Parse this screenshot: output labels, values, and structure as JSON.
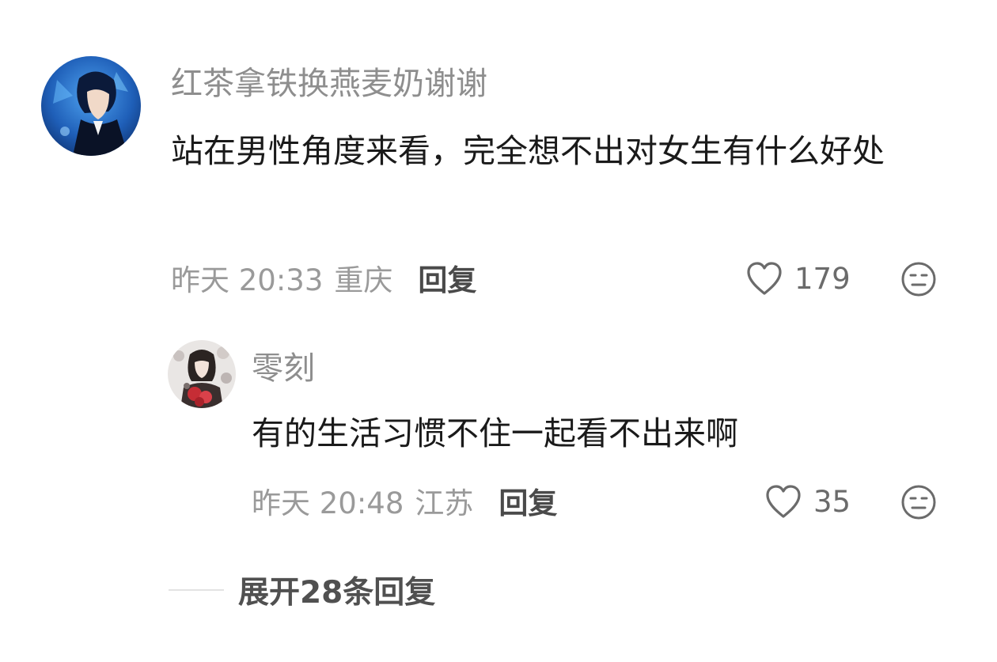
{
  "comments": [
    {
      "username": "红茶拿铁换燕麦奶谢谢",
      "text": "站在男性角度来看，完全想不出对女生有什么好处",
      "time": "昨天 20:33",
      "location": "重庆",
      "reply_label": "回复",
      "likes": "179",
      "avatar_icon": "anime-boy-blue-avatar"
    },
    {
      "username": "零刻",
      "text": "有的生活习惯不住一起看不出来啊",
      "time": "昨天 20:48",
      "location": "江苏",
      "reply_label": "回复",
      "likes": "35",
      "avatar_icon": "anime-girl-flowers-avatar"
    }
  ],
  "expand_replies": {
    "label": "展开28条回复"
  },
  "icons": {
    "like": "heart-outline-icon",
    "dislike": "meh-face-icon"
  },
  "colors": {
    "username": "#8e8e8e",
    "content": "#1a1a1a",
    "meta": "#9a9a9a",
    "reply": "#4a4a4a"
  }
}
